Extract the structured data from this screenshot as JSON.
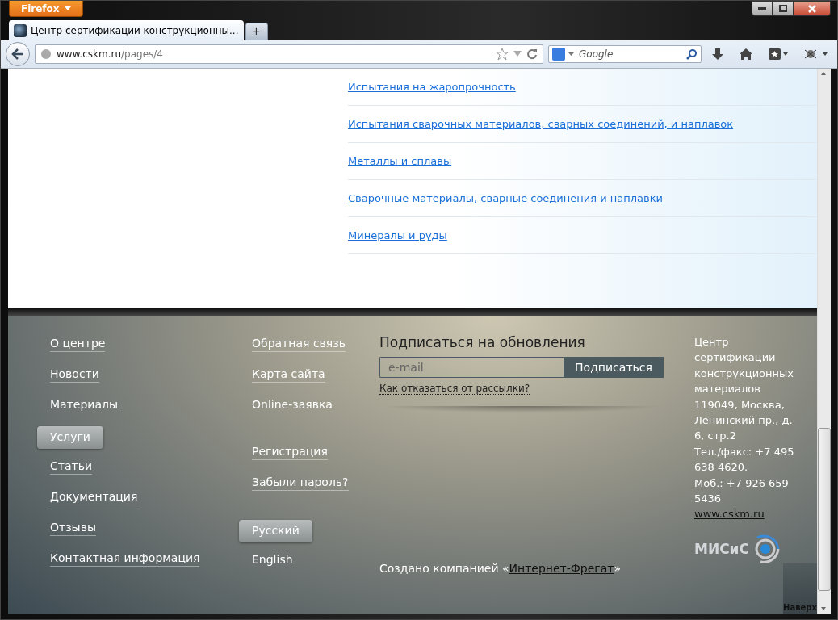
{
  "browser": {
    "menu_button": "Firefox",
    "tab": {
      "title": "Центр сертификации конструкционны...",
      "selected": true
    },
    "new_tab": "+",
    "url_host": "www.cskm.ru",
    "url_path": "/pages/4",
    "search_placeholder": "Google"
  },
  "content_links": [
    "Испытания на жаропрочность",
    "Испытания сварочных материалов, сварных соединений, и наплавок",
    "Металлы и сплавы",
    "Сварочные материалы, сварные соединения и наплавки",
    "Минералы и руды"
  ],
  "footer": {
    "main_nav": [
      {
        "label": "О центре",
        "selected": false
      },
      {
        "label": "Новости",
        "selected": false
      },
      {
        "label": "Материалы",
        "selected": false
      },
      {
        "label": "Услуги",
        "selected": true
      },
      {
        "label": "Статьи",
        "selected": false
      },
      {
        "label": "Документация",
        "selected": false
      },
      {
        "label": "Отзывы",
        "selected": false
      },
      {
        "label": "Контактная информация",
        "selected": false
      }
    ],
    "secondary_nav": [
      [
        {
          "label": "Обратная связь",
          "selected": false
        },
        {
          "label": "Карта сайта",
          "selected": false
        },
        {
          "label": "Online-заявка",
          "selected": false
        }
      ],
      [
        {
          "label": "Регистрация",
          "selected": false
        },
        {
          "label": "Забыли пароль?",
          "selected": false
        }
      ],
      [
        {
          "label": "Русский",
          "selected": true
        },
        {
          "label": "English",
          "selected": false
        }
      ]
    ],
    "subscribe": {
      "title": "Подписаться на обновления",
      "placeholder": "e-mail",
      "button": "Подписаться",
      "unsubscribe_link": "Как отказаться от рассылки?"
    },
    "credit": {
      "prefix": "Создано компанией «",
      "link": "Интернет-Фрегат",
      "suffix": "»"
    },
    "address_lines": [
      "Центр",
      "сертификации",
      "конструкционных",
      "материалов",
      "119049, Москва,",
      "Ленинский пр., д.",
      "6, стр.2",
      "Тел./факс: +7 495",
      "638 4620.",
      "Моб.: +7 926 659",
      "5436"
    ],
    "website": "www.cskm.ru",
    "logo_text": "МИСиС",
    "back_to_top": "Наверх"
  }
}
